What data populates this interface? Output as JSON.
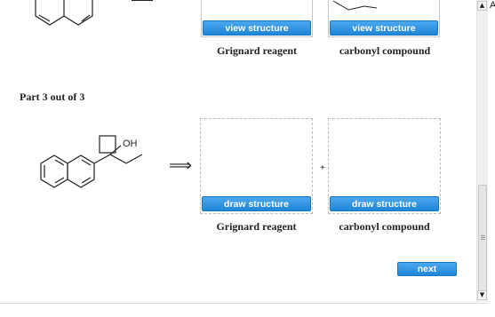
{
  "part2": {
    "slot1_button": "view structure",
    "slot1_caption": "Grignard reagent",
    "slot2_button": "view structure",
    "slot2_caption": "carbonyl compound"
  },
  "part3": {
    "heading": "Part 3 out of 3",
    "molecule_label": "OH",
    "arrow": "⟹",
    "plus": "+",
    "slot1_button": "draw structure",
    "slot1_caption": "Grignard reagent",
    "slot2_button": "draw structure",
    "slot2_caption": "carbonyl compound"
  },
  "next_button": "next",
  "edge_char": "A",
  "scroll": {
    "up_icon": "▲",
    "down_icon": "▼"
  },
  "colors": {
    "button_blue": "#1f86d6",
    "slot_border": "#bdbdbd"
  }
}
